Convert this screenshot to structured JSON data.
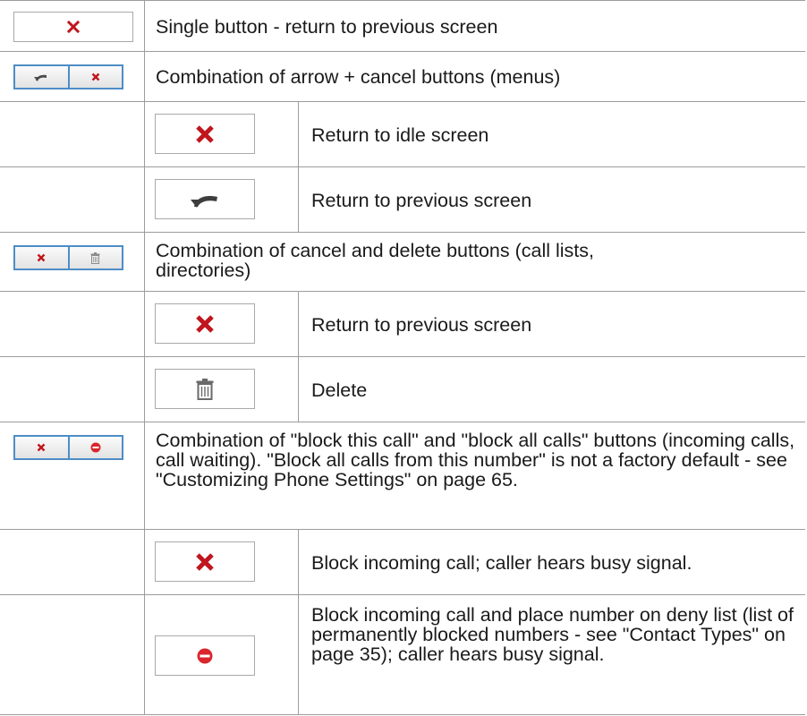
{
  "colors": {
    "cancel_red": "#c0161d",
    "frame_blue": "#4d8dc6",
    "grid": "#9c9c9c"
  },
  "rows": [
    {
      "icons": [
        "x-icon"
      ],
      "text": "Single button - return to previous screen"
    },
    {
      "icons": [
        "back-arrow-icon",
        "x-icon"
      ],
      "text": "Combination of arrow + cancel buttons (menus)"
    },
    {
      "icons": [
        "x-icon"
      ],
      "text": "Return to idle screen"
    },
    {
      "icons": [
        "back-arrow-icon"
      ],
      "text": "Return to previous screen"
    },
    {
      "icons": [
        "x-icon",
        "trash-icon"
      ],
      "text": "Combination of cancel and delete buttons (call lists, directories)"
    },
    {
      "icons": [
        "x-icon"
      ],
      "text": "Return to previous screen"
    },
    {
      "icons": [
        "trash-icon"
      ],
      "text": "Delete"
    },
    {
      "icons": [
        "x-icon",
        "block-icon"
      ],
      "text": "Combination of \"block this call\" and \"block all calls\" buttons (incoming calls, call waiting).  \"Block all calls from this number\" is not a factory default - see \"Customizing Phone Settings\" on page 65."
    },
    {
      "icons": [
        "x-icon"
      ],
      "text": "Block incoming call; caller hears busy signal."
    },
    {
      "icons": [
        "block-icon"
      ],
      "text": "Block incoming call and place number on deny list (list of permanently blocked numbers - see \"Contact Types\" on page 35); caller hears busy signal."
    }
  ]
}
